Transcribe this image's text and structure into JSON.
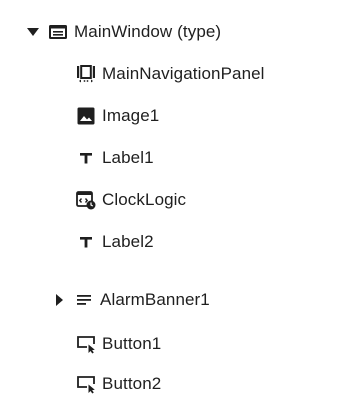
{
  "tree": {
    "items": [
      {
        "label": "MainWindow (type)",
        "icon": "window-icon",
        "expanded": true
      },
      {
        "label": "MainNavigationPanel",
        "icon": "navigation-panel-icon"
      },
      {
        "label": "Image1",
        "icon": "image-icon"
      },
      {
        "label": "Label1",
        "icon": "text-label-icon"
      },
      {
        "label": "ClockLogic",
        "icon": "script-logic-icon"
      },
      {
        "label": "Label2",
        "icon": "text-label-icon"
      },
      {
        "label": "AlarmBanner1",
        "icon": "list-banner-icon",
        "expanded": false
      },
      {
        "label": "Button1",
        "icon": "button-cursor-icon"
      },
      {
        "label": "Button2",
        "icon": "button-cursor-icon"
      }
    ]
  }
}
